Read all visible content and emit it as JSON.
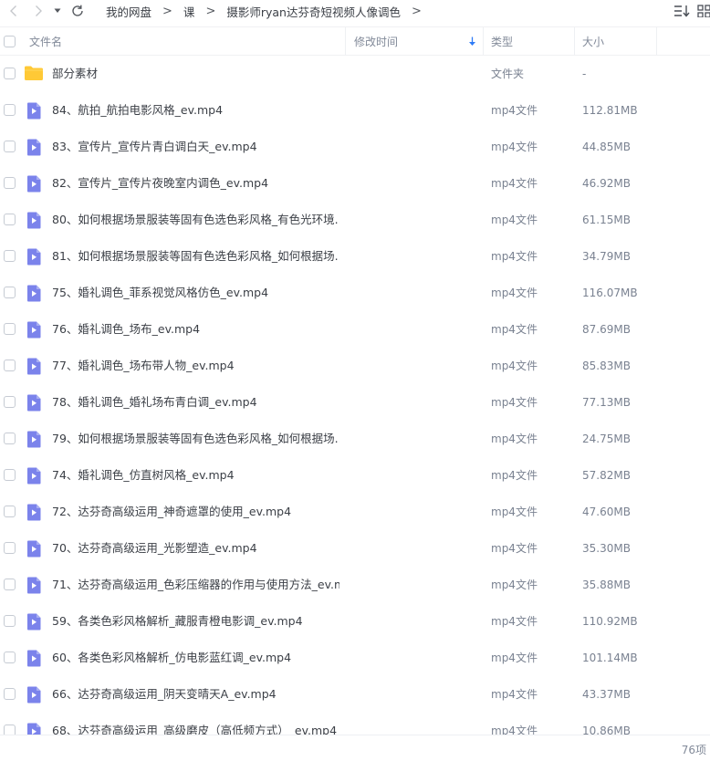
{
  "colors": {
    "video_icon": "#7b83eb",
    "folder_icon": "#ffc936",
    "sort_arrow": "#2e7bf6"
  },
  "breadcrumb": [
    "我的网盘",
    "课",
    "摄影师ryan达芬奇短视频人像调色"
  ],
  "breadcrumb_sep": ">",
  "columns": {
    "name": "文件名",
    "modified": "修改时间",
    "type": "类型",
    "size": "大小"
  },
  "files": [
    {
      "name": "部分素材",
      "type": "文件夹",
      "size": "-",
      "icon": "folder-icon"
    },
    {
      "name": "84、航拍_航拍电影风格_ev.mp4",
      "type": "mp4文件",
      "size": "112.81MB",
      "icon": "video-file-icon"
    },
    {
      "name": "83、宣传片_宣传片青白调白天_ev.mp4",
      "type": "mp4文件",
      "size": "44.85MB",
      "icon": "video-file-icon"
    },
    {
      "name": "82、宣传片_宣传片夜晚室内调色_ev.mp4",
      "type": "mp4文件",
      "size": "46.92MB",
      "icon": "video-file-icon"
    },
    {
      "name": "80、如何根据场景服装等固有色选色彩风格_有色光环境...",
      "type": "mp4文件",
      "size": "61.15MB",
      "icon": "video-file-icon"
    },
    {
      "name": "81、如何根据场景服装等固有色选色彩风格_如何根据场...",
      "type": "mp4文件",
      "size": "34.79MB",
      "icon": "video-file-icon"
    },
    {
      "name": "75、婚礼调色_菲系视觉风格仿色_ev.mp4",
      "type": "mp4文件",
      "size": "116.07MB",
      "icon": "video-file-icon"
    },
    {
      "name": "76、婚礼调色_场布_ev.mp4",
      "type": "mp4文件",
      "size": "87.69MB",
      "icon": "video-file-icon"
    },
    {
      "name": "77、婚礼调色_场布带人物_ev.mp4",
      "type": "mp4文件",
      "size": "85.83MB",
      "icon": "video-file-icon"
    },
    {
      "name": "78、婚礼调色_婚礼场布青白调_ev.mp4",
      "type": "mp4文件",
      "size": "77.13MB",
      "icon": "video-file-icon"
    },
    {
      "name": "79、如何根据场景服装等固有色选色彩风格_如何根据场...",
      "type": "mp4文件",
      "size": "24.75MB",
      "icon": "video-file-icon"
    },
    {
      "name": "74、婚礼调色_仿直树风格_ev.mp4",
      "type": "mp4文件",
      "size": "57.82MB",
      "icon": "video-file-icon"
    },
    {
      "name": "72、达芬奇高级运用_神奇遮罩的使用_ev.mp4",
      "type": "mp4文件",
      "size": "47.60MB",
      "icon": "video-file-icon"
    },
    {
      "name": "70、达芬奇高级运用_光影塑造_ev.mp4",
      "type": "mp4文件",
      "size": "35.30MB",
      "icon": "video-file-icon"
    },
    {
      "name": "71、达芬奇高级运用_色彩压缩器的作用与使用方法_ev.m...",
      "type": "mp4文件",
      "size": "35.88MB",
      "icon": "video-file-icon"
    },
    {
      "name": "59、各类色彩风格解析_藏服青橙电影调_ev.mp4",
      "type": "mp4文件",
      "size": "110.92MB",
      "icon": "video-file-icon"
    },
    {
      "name": "60、各类色彩风格解析_仿电影蓝红调_ev.mp4",
      "type": "mp4文件",
      "size": "101.14MB",
      "icon": "video-file-icon"
    },
    {
      "name": "66、达芬奇高级运用_阴天变晴天A_ev.mp4",
      "type": "mp4文件",
      "size": "43.37MB",
      "icon": "video-file-icon"
    },
    {
      "name": "68、达芬奇高级运用_高级磨皮（高低频方式）_ev.mp4",
      "type": "mp4文件",
      "size": "10.86MB",
      "icon": "video-file-icon"
    }
  ],
  "footer": {
    "count": "76项"
  }
}
